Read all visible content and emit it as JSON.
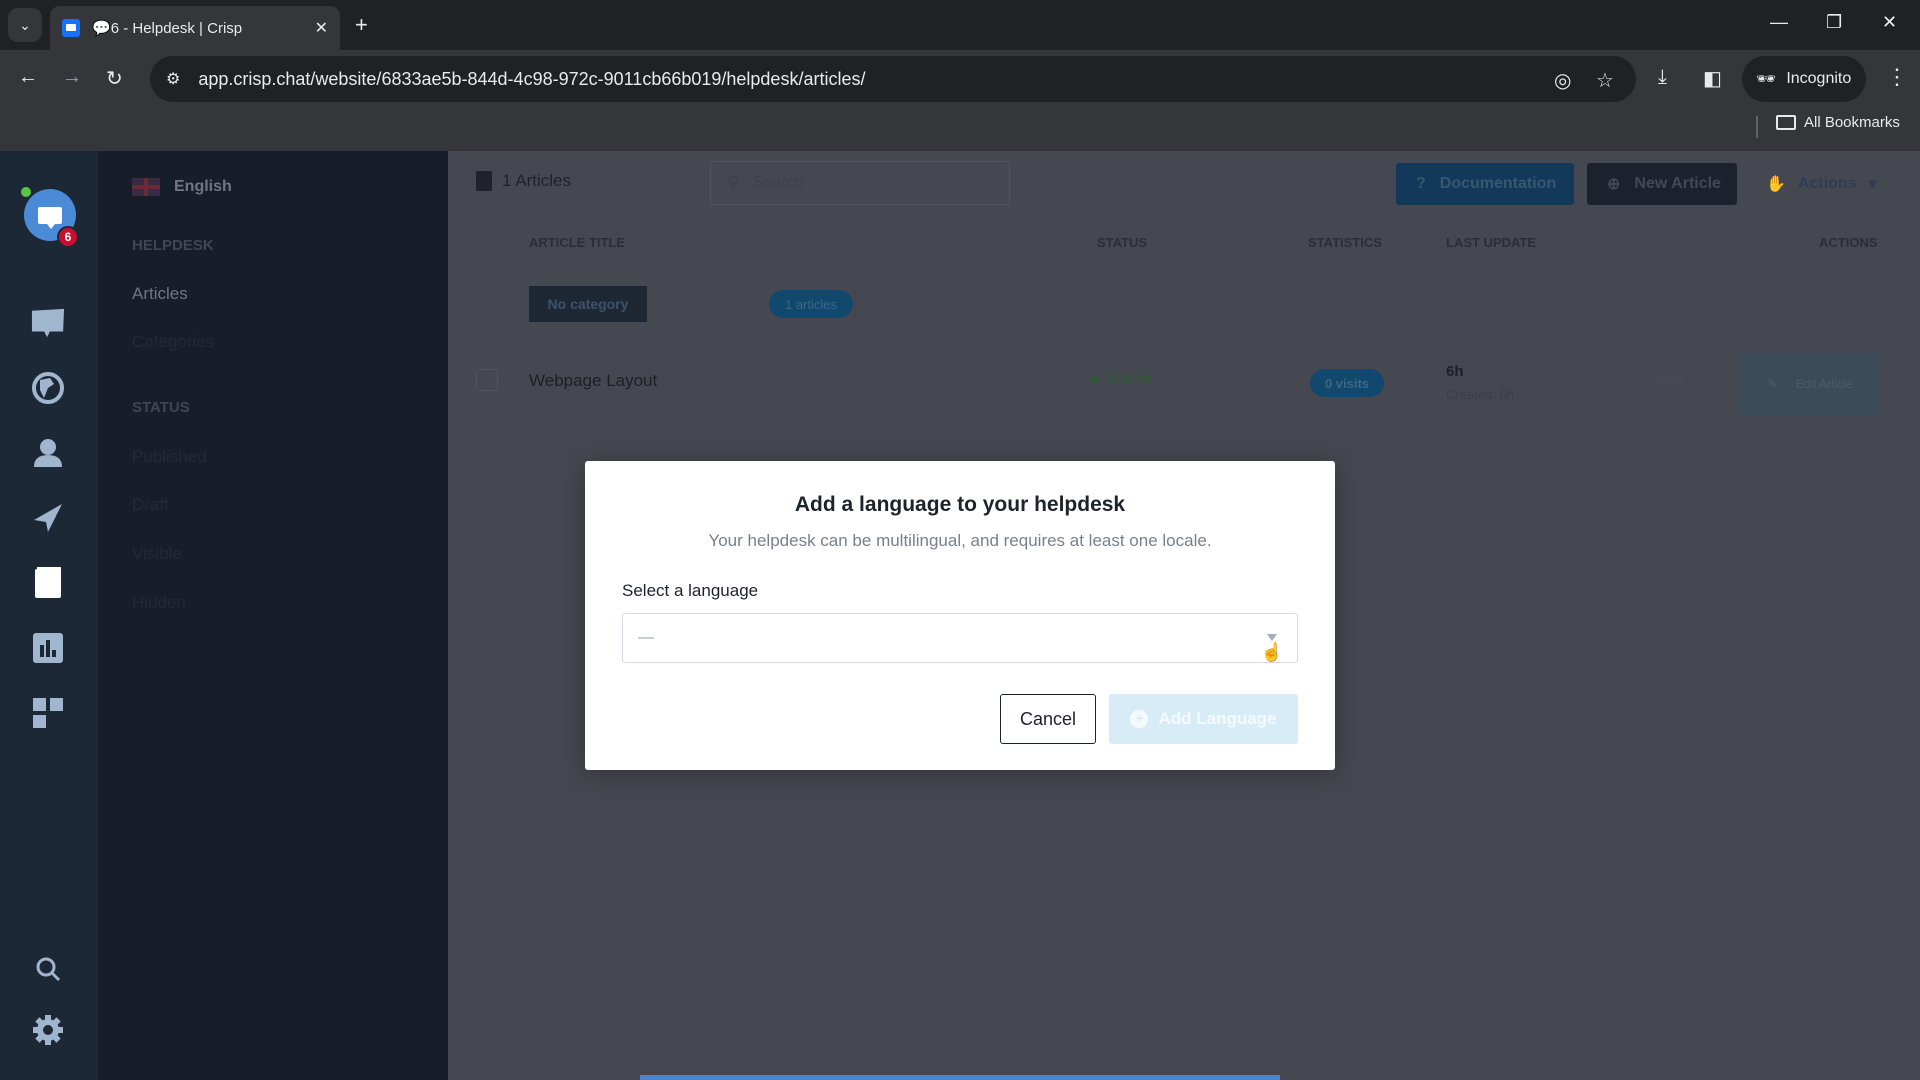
{
  "browser": {
    "tab_title": "6 - Helpdesk | Crisp",
    "tab_prefix_icon": "chat-bubble-icon",
    "url": "app.crisp.chat/website/6833ae5b-844d-4c98-972c-9011cb66b019/helpdesk/articles/",
    "profile_label": "Incognito",
    "bookmarks_label": "All Bookmarks"
  },
  "rail": {
    "badge_count": "6",
    "items": [
      "chat-icon",
      "globe-icon",
      "contacts-icon",
      "campaigns-icon",
      "helpdesk-icon",
      "analytics-icon",
      "plugins-icon",
      "search-icon",
      "settings-icon"
    ]
  },
  "sidebar": {
    "language": "English",
    "sections": [
      {
        "title": "HELPDESK",
        "items": [
          "Articles",
          "Categories"
        ]
      },
      {
        "title": "STATUS",
        "items": [
          "Published",
          "Draft",
          "Visible",
          "Hidden"
        ]
      }
    ]
  },
  "main": {
    "title": "1 Articles",
    "search_placeholder": "Search",
    "documentation_label": "Documentation",
    "new_article_label": "New Article",
    "actions_label": "Actions",
    "columns": [
      "ARTICLE TITLE",
      "STATUS",
      "STATISTICS",
      "LAST UPDATE",
      "ACTIONS"
    ],
    "category": {
      "name": "No category",
      "count": "1 articles"
    },
    "rows": [
      {
        "title": "Webpage Layout",
        "status": "Online",
        "visits": "0 visits",
        "updated": "6h",
        "created": "Created: 6h",
        "view_label": "View",
        "edit_label": "Edit Article"
      }
    ],
    "status_color": "#2f5a33",
    "loading_progress_percent": 100
  },
  "modal": {
    "title": "Add a language to your helpdesk",
    "subtitle": "Your helpdesk can be multilingual, and requires at least one locale.",
    "field_label": "Select a language",
    "select_value": "—",
    "cancel_label": "Cancel",
    "add_label": "Add Language"
  }
}
